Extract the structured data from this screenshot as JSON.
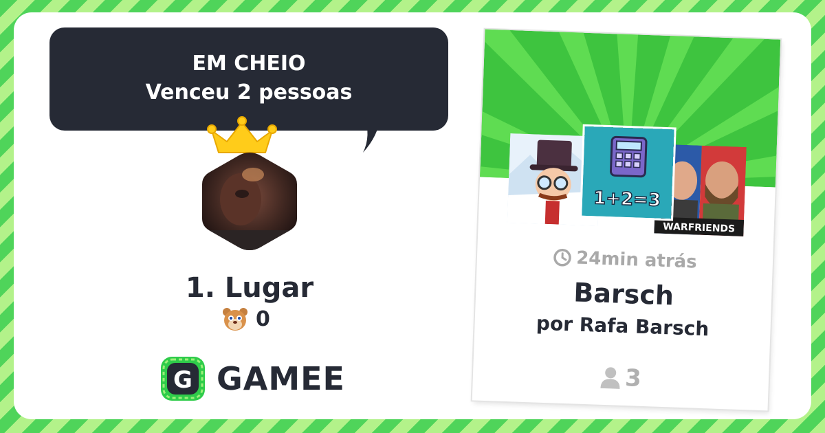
{
  "result": {
    "headline": "EM CHEIO",
    "subline": "Venceu 2 pessoas"
  },
  "player": {
    "place": "1. Lugar",
    "score": "0"
  },
  "brand": {
    "logo_letter": "G",
    "name": "GAMEE"
  },
  "game_card": {
    "time_ago": "24min atrás",
    "title": "Barsch",
    "author": "por Rafa Barsch",
    "players": "3",
    "thumbnails": [
      {
        "label": ""
      },
      {
        "label": "1+2=3"
      },
      {
        "label": "WARFRIENDS"
      }
    ]
  },
  "colors": {
    "stripe_dark": "#4fd45a",
    "stripe_light": "#b3f28a",
    "bubble": "#262a35",
    "text_dark": "#262a35",
    "muted": "#a9a9a9",
    "crown": "#ffcc1a"
  },
  "icons": [
    "crown-icon",
    "hamster-icon",
    "clock-icon",
    "person-icon",
    "gamee-logo-icon"
  ]
}
